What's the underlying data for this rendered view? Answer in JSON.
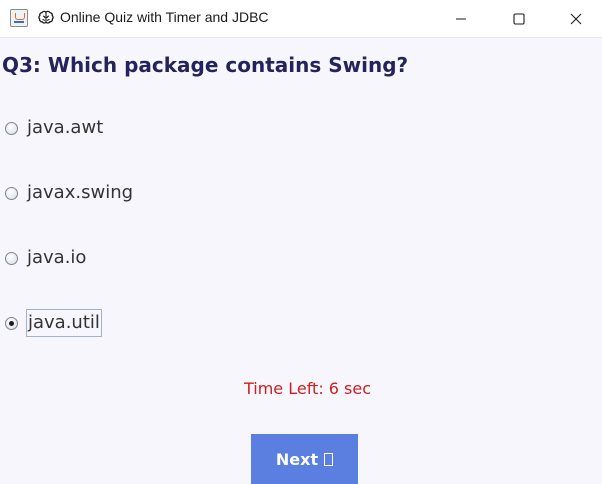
{
  "window": {
    "title": "Online Quiz with Timer and JDBC",
    "app_icon": "java-app-icon",
    "title_icon": "brain-icon"
  },
  "question": {
    "text": "Q3: Which package contains Swing?",
    "color": "#25245a"
  },
  "options": [
    {
      "label": "java.awt",
      "selected": false
    },
    {
      "label": "javax.swing",
      "selected": false
    },
    {
      "label": "java.io",
      "selected": false
    },
    {
      "label": "java.util",
      "selected": true
    }
  ],
  "timer": {
    "text": "Time Left: 6 sec",
    "color": "#cc1f1f"
  },
  "next_button": {
    "label": "Next",
    "icon": "missing-glyph-icon",
    "color": "#5b7fe0"
  }
}
